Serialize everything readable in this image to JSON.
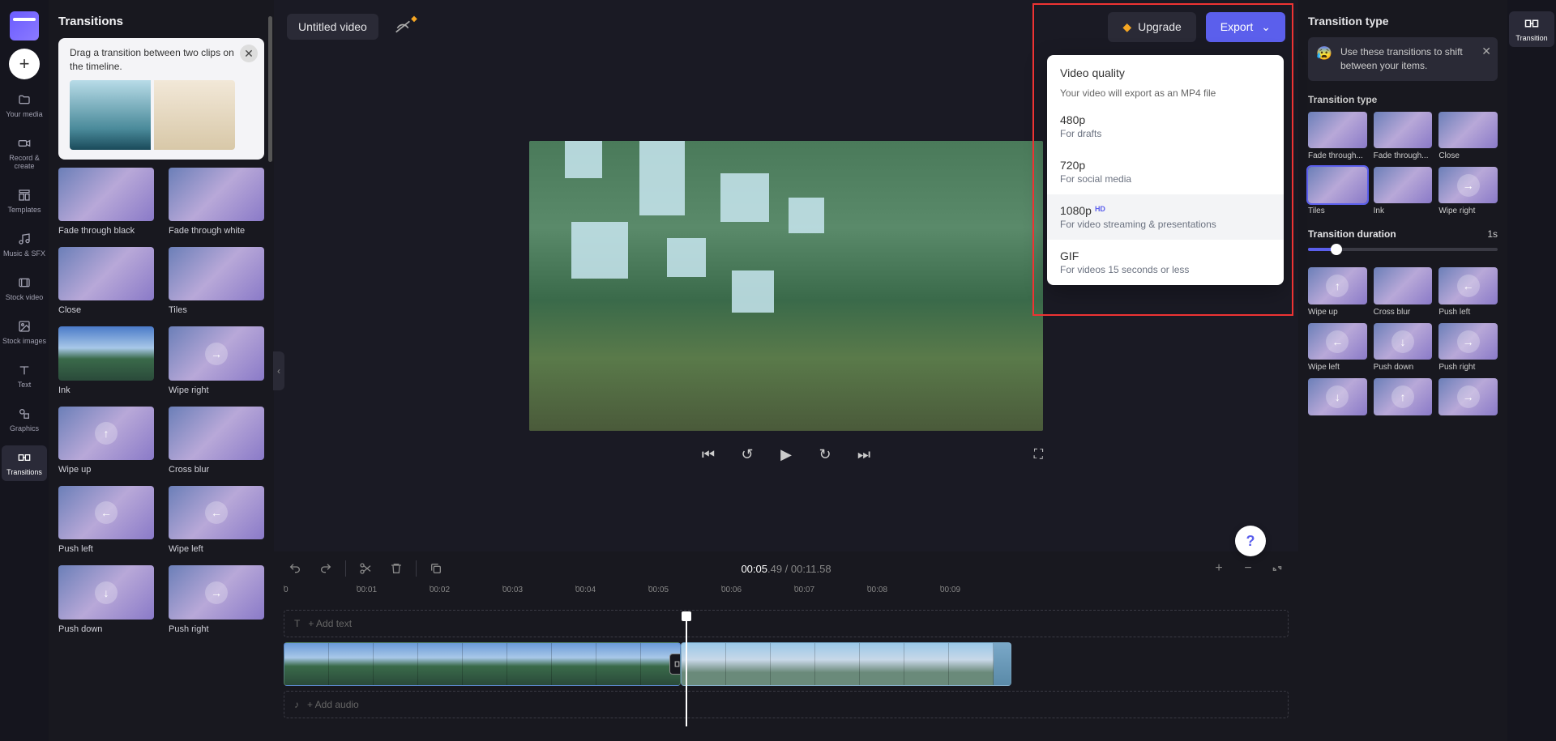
{
  "leftRail": {
    "items": [
      {
        "label": "Your media"
      },
      {
        "label": "Record & create"
      },
      {
        "label": "Templates"
      },
      {
        "label": "Music & SFX"
      },
      {
        "label": "Stock video"
      },
      {
        "label": "Stock images"
      },
      {
        "label": "Text"
      },
      {
        "label": "Graphics"
      },
      {
        "label": "Transitions"
      }
    ]
  },
  "transitionsPanel": {
    "title": "Transitions",
    "tip": "Drag a transition between two clips on the timeline.",
    "items": [
      {
        "label": "Fade through black"
      },
      {
        "label": "Fade through white"
      },
      {
        "label": "Close"
      },
      {
        "label": "Tiles"
      },
      {
        "label": "Ink"
      },
      {
        "label": "Wipe right"
      },
      {
        "label": "Wipe up"
      },
      {
        "label": "Cross blur"
      },
      {
        "label": "Push left"
      },
      {
        "label": "Wipe left"
      },
      {
        "label": "Push down"
      },
      {
        "label": "Push right"
      }
    ]
  },
  "topBar": {
    "videoTitle": "Untitled video",
    "upgrade": "Upgrade",
    "export": "Export"
  },
  "exportMenu": {
    "heading": "Video quality",
    "subheading": "Your video will export as an MP4 file",
    "options": [
      {
        "label": "480p",
        "desc": "For drafts",
        "hd": false
      },
      {
        "label": "720p",
        "desc": "For social media",
        "hd": false
      },
      {
        "label": "1080p",
        "desc": "For video streaming & presentations",
        "hd": true
      },
      {
        "label": "GIF",
        "desc": "For videos 15 seconds or less",
        "hd": false
      }
    ]
  },
  "timeline": {
    "current": "00:05",
    "currentFrac": ".49",
    "total": "00:11",
    "totalFrac": ".58",
    "ticks": [
      "0",
      "00:01",
      "00:02",
      "00:03",
      "00:04",
      "00:05",
      "00:06",
      "00:07",
      "00:08",
      "00:09"
    ],
    "addText": "+ Add text",
    "addAudio": "+ Add audio"
  },
  "rightPanel": {
    "title": "Transition type",
    "info": "Use these transitions to shift between your items.",
    "sectionType": "Transition type",
    "types": [
      {
        "label": "Fade through..."
      },
      {
        "label": "Fade through..."
      },
      {
        "label": "Close"
      },
      {
        "label": "Tiles"
      },
      {
        "label": "Ink"
      },
      {
        "label": "Wipe right"
      },
      {
        "label": "Wipe up"
      },
      {
        "label": "Cross blur"
      },
      {
        "label": "Push left"
      },
      {
        "label": "Wipe left"
      },
      {
        "label": "Push down"
      },
      {
        "label": "Push right"
      }
    ],
    "durationLabel": "Transition duration",
    "durationValue": "1s"
  },
  "rightRail": {
    "label": "Transition"
  }
}
